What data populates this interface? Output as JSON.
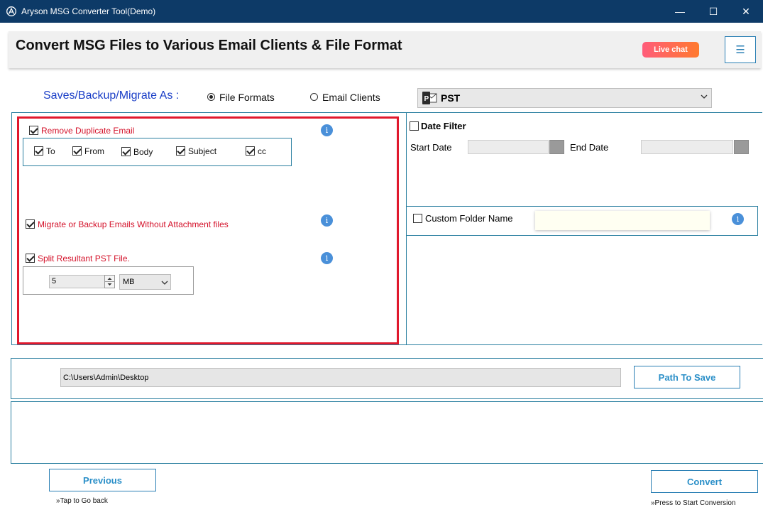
{
  "window": {
    "title": "Aryson MSG Converter Tool(Demo)",
    "controls": {
      "minimize": "—",
      "maximize": "☐",
      "close": "✕"
    }
  },
  "header": {
    "heading": "Convert MSG Files to Various Email Clients & File Format",
    "live_chat": "Live chat",
    "menu_icon": "☰"
  },
  "saves": {
    "label": "Saves/Backup/Migrate As :",
    "options": [
      {
        "label": "File Formats",
        "selected": true
      },
      {
        "label": "Email Clients",
        "selected": false
      }
    ],
    "format_selected": "PST",
    "format_icon": "outlook-pst-icon"
  },
  "options": {
    "remove_duplicate": {
      "label": "Remove Duplicate Email",
      "checked": true
    },
    "duplicate_fields": [
      {
        "label": "To",
        "checked": true
      },
      {
        "label": "From",
        "checked": true
      },
      {
        "label": "Body",
        "checked": true
      },
      {
        "label": "Subject",
        "checked": true
      },
      {
        "label": "cc",
        "checked": true
      }
    ],
    "without_attachments": {
      "label": "Migrate or Backup Emails Without Attachment files",
      "checked": true
    },
    "split": {
      "label": "Split Resultant PST File.",
      "checked": true,
      "size": "5",
      "unit": "MB"
    },
    "info_glyph": "i"
  },
  "date_filter": {
    "label": "Date Filter",
    "checked": false,
    "start_label": "Start Date",
    "end_label": "End Date"
  },
  "custom_folder": {
    "label": "Custom Folder Name",
    "checked": false,
    "value": ""
  },
  "path": {
    "value": "C:\\Users\\Admin\\Desktop",
    "button": "Path To Save"
  },
  "nav": {
    "previous": "Previous",
    "previous_hint": "»Tap to Go back",
    "convert": "Convert",
    "convert_hint": "»Press to Start Conversion"
  },
  "colors": {
    "titlebar": "#0d3a67",
    "accent": "#2a7fb4",
    "highlight": "#e0182d",
    "option_text": "#d4122a"
  }
}
